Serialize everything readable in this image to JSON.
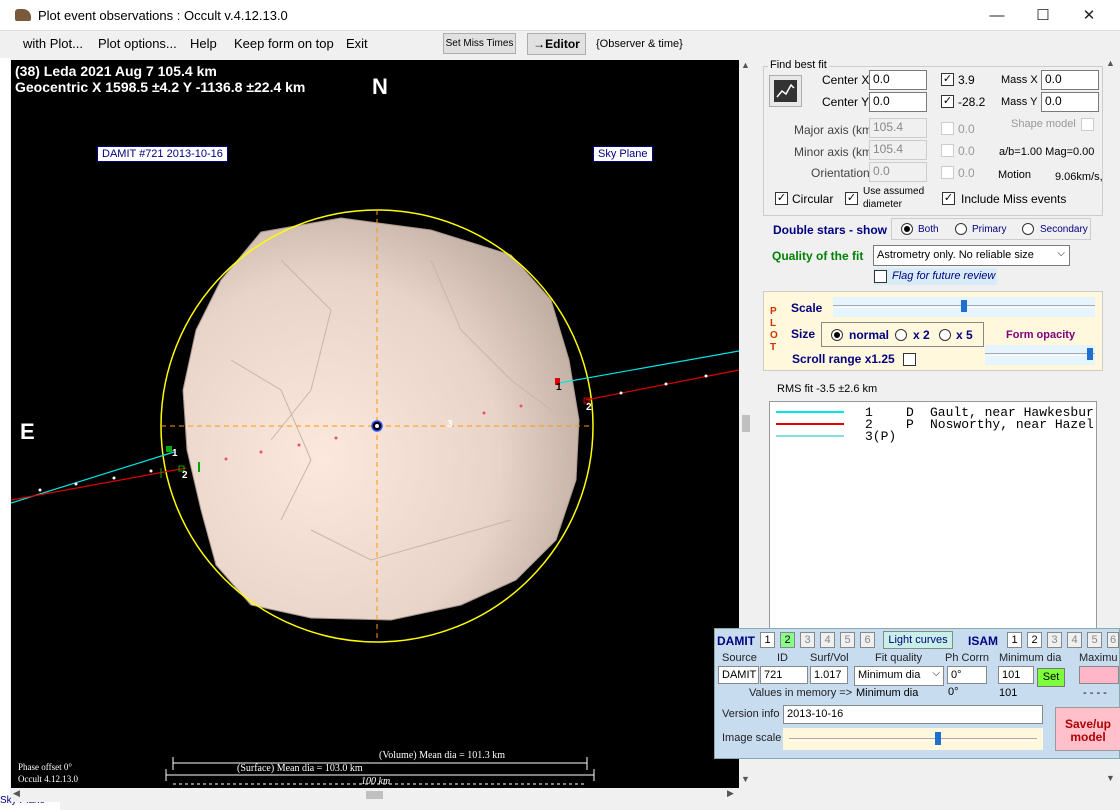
{
  "window": {
    "title": "Plot event observations : Occult v.4.12.13.0",
    "minimize": "—",
    "maximize": "☐",
    "close": "✕"
  },
  "menu": {
    "items": [
      "with Plot...",
      "Plot options...",
      "Help",
      "Keep form on top",
      "Exit"
    ],
    "set_miss_times": "Set Miss Times",
    "editor": "→Editor",
    "observer_time": "{Observer & time}"
  },
  "plot": {
    "header_line1": "(38) Leda  2021 Aug 7   105.4 km",
    "header_line2": "Geocentric  X  1598.5 ±4.2  Y -1136.8 ±22.4 km",
    "north": "N",
    "east": "E",
    "damit_label": "DAMIT #721 2013-10-16",
    "sky_plane": "Sky Plane",
    "chord1": "1",
    "chord2": "2",
    "chord3": "3",
    "volume_dia": "(Volume) Mean dia = 101.3 km",
    "surface_dia": "(Surface) Mean dia = 103.0 km",
    "scale_100": "100 km",
    "phase_offset": "Phase offset 0°",
    "occult_version": "Occult 4.12.13.0",
    "left_cut_label": "Sky Plane"
  },
  "fit": {
    "group_label": "Find best fit",
    "center_x_label": "Center X",
    "center_x": "0.0",
    "center_y_label": "Center Y",
    "center_y": "0.0",
    "fit_x_value": "3.9",
    "fit_y_value": "-28.2",
    "mass_x_label": "Mass X",
    "mass_x": "0.0",
    "mass_y_label": "Mass Y",
    "mass_y": "0.0",
    "major_label": "Major axis (km)",
    "major": "105.4",
    "major_fit": "0.0",
    "minor_label": "Minor axis (km)",
    "minor": "105.4",
    "minor_fit": "0.0",
    "orient_label": "Orientation",
    "orient": "0.0",
    "orient_fit": "0.0",
    "shape_model": "Shape model",
    "ab_ratio": "a/b=1.00  Mag=0.00",
    "motion_label": "Motion",
    "motion": "9.06km/s,",
    "circular": "Circular",
    "use_assumed_1": "Use assumed",
    "use_assumed_2": "diameter",
    "include_miss": "Include Miss events"
  },
  "double_stars": {
    "label": "Double stars - show",
    "both": "Both",
    "primary": "Primary",
    "secondary": "Secondary"
  },
  "quality": {
    "label": "Quality of the fit",
    "value": "Astrometry only. No reliable size",
    "flag": "Flag for future review"
  },
  "plot_opts": {
    "plot_letters": [
      "P",
      "L",
      "O",
      "T"
    ],
    "scale": "Scale",
    "scale_level": 0.5,
    "size": "Size",
    "normal": "normal",
    "x2": "x 2",
    "x5": "x 5",
    "form_opacity": "Form opacity",
    "opacity_level": 0.98,
    "scroll_range": "Scroll range x1.25"
  },
  "rms": "RMS fit  -3.5 ±2.6 km",
  "legend": [
    {
      "num": "1",
      "type": "D",
      "name": "Gault, near Hawkesbur",
      "color": "#00e5e5"
    },
    {
      "num": "2",
      "type": "P",
      "name": "Nosworthy, near Hazel",
      "color": "#e00000"
    },
    {
      "num": "3(P)",
      "type": "",
      "name": "",
      "color": "#7fe0e0"
    }
  ],
  "damit": {
    "label": "DAMIT",
    "nums": [
      "1",
      "2",
      "3",
      "4",
      "5",
      "6"
    ],
    "light_curves": "Light curves",
    "isam_label": "ISAM",
    "isam_nums": [
      "1",
      "2",
      "3",
      "4",
      "5",
      "6"
    ],
    "source_label": "Source",
    "id_label": "ID",
    "surfvol_label": "Surf/Vol",
    "fitq_label": "Fit quality",
    "phcorr_label": "Ph Corrn",
    "mindia_label": "Minimum dia",
    "maxdia_label": "Maximu",
    "source": "DAMIT",
    "id": "721",
    "surfvol": "1.017",
    "fitq": "Minimum dia",
    "phcorr": "0°",
    "mindia": "101",
    "set": "Set",
    "values_memory": "Values in memory =>",
    "mem_fitq": "Minimum dia",
    "mem_phcorr": "0°",
    "mem_mindia": "101",
    "mem_max": "- - - -",
    "version_label": "Version info",
    "version": "2013-10-16",
    "image_scale": "Image scale",
    "image_scale_level": 0.6,
    "save": "Save/up model"
  },
  "colors": {
    "plot_bg": "#000000",
    "chord1": "#00e5e5",
    "chord2": "#e00000",
    "ellipse": "#ffff00",
    "crosshair": "#ff9900",
    "damit_panel": "#c8dcf0"
  }
}
